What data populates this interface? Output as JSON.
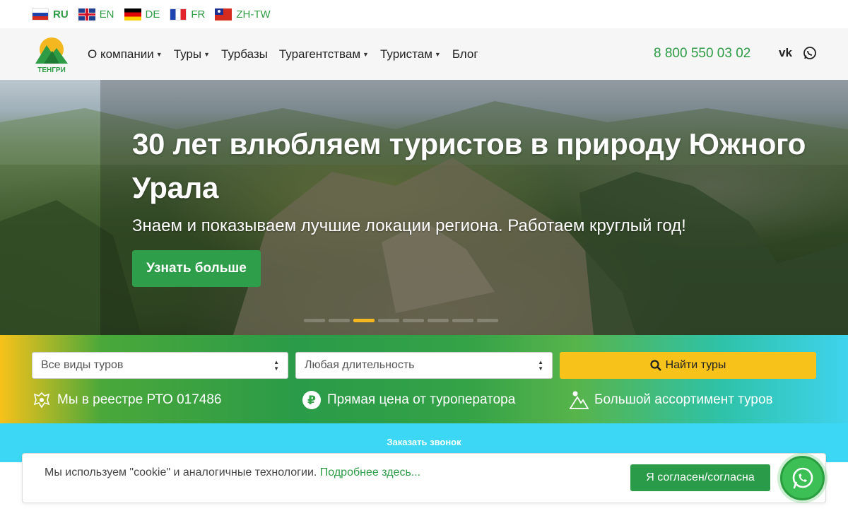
{
  "languages": [
    {
      "code": "RU",
      "active": true
    },
    {
      "code": "EN",
      "active": false
    },
    {
      "code": "DE",
      "active": false
    },
    {
      "code": "FR",
      "active": false
    },
    {
      "code": "ZH-TW",
      "active": false
    }
  ],
  "header": {
    "logo_text": "ТЕНГРИ",
    "nav": [
      {
        "label": "О компании",
        "dropdown": true
      },
      {
        "label": "Туры",
        "dropdown": true
      },
      {
        "label": "Турбазы",
        "dropdown": false
      },
      {
        "label": "Турагентствам",
        "dropdown": true
      },
      {
        "label": "Туристам",
        "dropdown": true
      },
      {
        "label": "Блог",
        "dropdown": false
      }
    ],
    "phone": "8 800 550 03 02",
    "social": {
      "vk": "vk-icon",
      "whatsapp": "whatsapp-icon"
    }
  },
  "hero": {
    "title": "30 лет влюбляем туристов в природу Южного Урала",
    "subtitle": "Знаем и показываем лучшие локации региона. Работаем круглый год!",
    "button": "Узнать больше",
    "slides_total": 8,
    "active_slide": 3
  },
  "search": {
    "tour_type": "Все виды туров",
    "duration": "Любая длительность",
    "button": "Найти туры"
  },
  "features": [
    {
      "icon": "emblem-icon",
      "text": "Мы в реестре РТО 017486"
    },
    {
      "icon": "ruble-icon",
      "text": "Прямая цена от туроператора"
    },
    {
      "icon": "mountain-icon",
      "text": "Большой ассортимент туров"
    }
  ],
  "call": {
    "label": "Заказать звонок"
  },
  "cookie": {
    "text": "Мы используем \"cookie\" и аналогичные технологии.",
    "link": "Подробнее здесь...",
    "button": "Я согласен/согласна"
  },
  "colors": {
    "accent_green": "#2e9b45",
    "accent_yellow": "#f7c21a",
    "cyan": "#3cd7f4"
  }
}
